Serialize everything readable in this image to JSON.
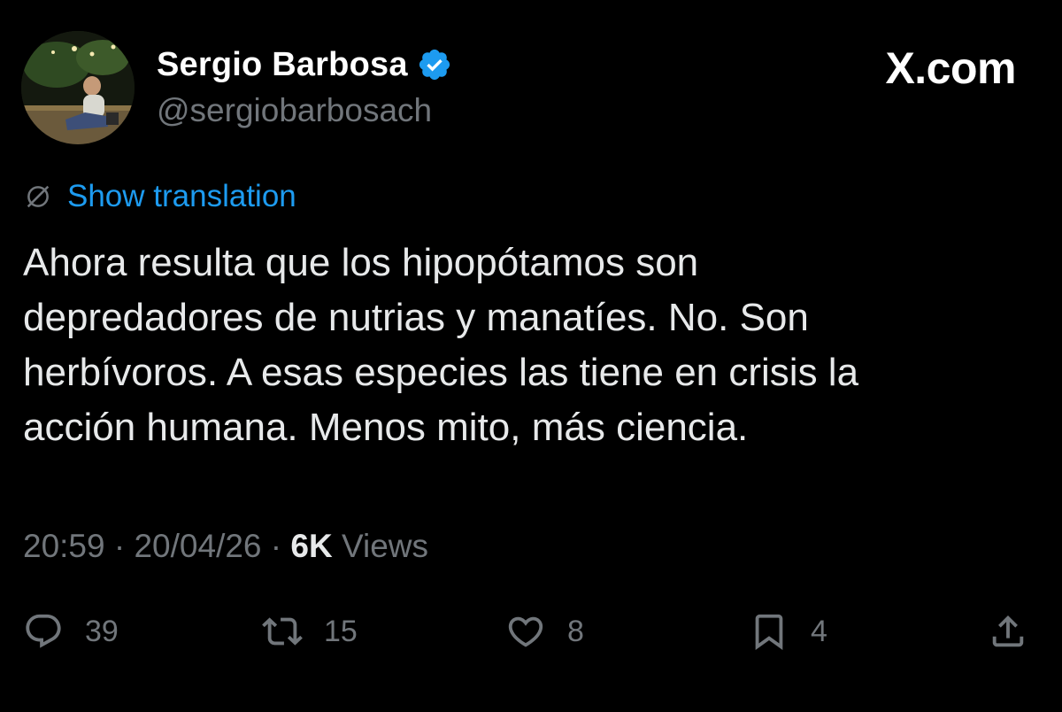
{
  "author": {
    "display_name": "Sergio Barbosa",
    "handle": "@sergiobarbosach",
    "verified": true
  },
  "brand": {
    "watermark": "X.com"
  },
  "translation": {
    "label": "Show translation"
  },
  "tweet": {
    "lines": [
      "Ahora resulta que los hipopótamos son",
      "depredadores de nutrias y manatíes. No. Son",
      "herbívoros. A esas especies las tiene en crisis la",
      "acción humana. Menos mito, más ciencia."
    ]
  },
  "meta": {
    "time": "20:59",
    "separator": " · ",
    "date": "20/04/26",
    "views_count": "6K",
    "views_label": " Views"
  },
  "actions": {
    "replies": "39",
    "reposts": "15",
    "likes": "8",
    "bookmarks": "4"
  },
  "colors": {
    "background": "#000000",
    "text": "#e7e9ea",
    "secondary": "#71767b",
    "accent": "#1d9bf0"
  },
  "icons": {
    "verified": "verified-badge-icon",
    "translate": "translate-icon",
    "reply": "reply-icon",
    "repost": "repost-icon",
    "like": "heart-icon",
    "bookmark": "bookmark-icon",
    "share": "share-icon"
  }
}
